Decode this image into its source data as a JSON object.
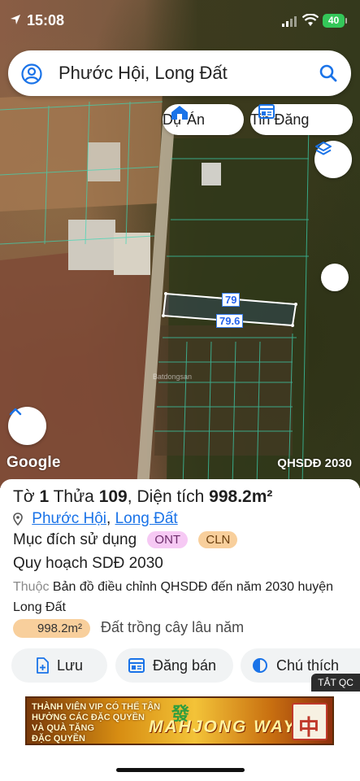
{
  "status_bar": {
    "time": "15:08",
    "battery": "40"
  },
  "search": {
    "query": "Phước Hội, Long Đất"
  },
  "chips": {
    "du_an": "Dự Án",
    "tin_dang": "Tin Đăng"
  },
  "map": {
    "dimension_top": "79",
    "dimension_bottom": "79.6",
    "google_label": "Google",
    "plan_badge": "QHSDĐ 2030",
    "watermark": "Batdongsan"
  },
  "parcel": {
    "sheet_label": "Tờ",
    "sheet_no": "1",
    "lot_label": "Thửa",
    "lot_no": "109",
    "area_label": "Diện tích",
    "area_value": "998.2m²",
    "ward": "Phước Hội",
    "district": "Long Đất",
    "purpose_label": "Mục đích sử dụng",
    "tag_ont": "ONT",
    "tag_cln": "CLN",
    "plan_title": "Quy hoạch SDĐ 2030",
    "belongs_label": "Thuộc",
    "belongs_text": "Bản đồ điều chỉnh QHSDĐ đến năm 2030 huyện Long Đất",
    "zone_area": "998.2m²",
    "zone_type": "Đất trồng cây lâu năm"
  },
  "actions": {
    "save": "Lưu",
    "post": "Đăng bán",
    "legend": "Chú thích"
  },
  "ad": {
    "close_label": "TẮT QC",
    "line1": "THÀNH VIÊN VIP CÓ THỂ TẬN",
    "line2": "HƯỞNG CÁC ĐẶC QUYỀN",
    "line3": "VÀ QUÀ TẶNG",
    "line4": "ĐẶC QUYỀN",
    "brand": "MAHJONG WAYS"
  },
  "colors": {
    "link": "#1a73e8",
    "parcel_outline": "#3b82f6",
    "ont": "#f6c9f4",
    "cln": "#f8cf9c"
  }
}
